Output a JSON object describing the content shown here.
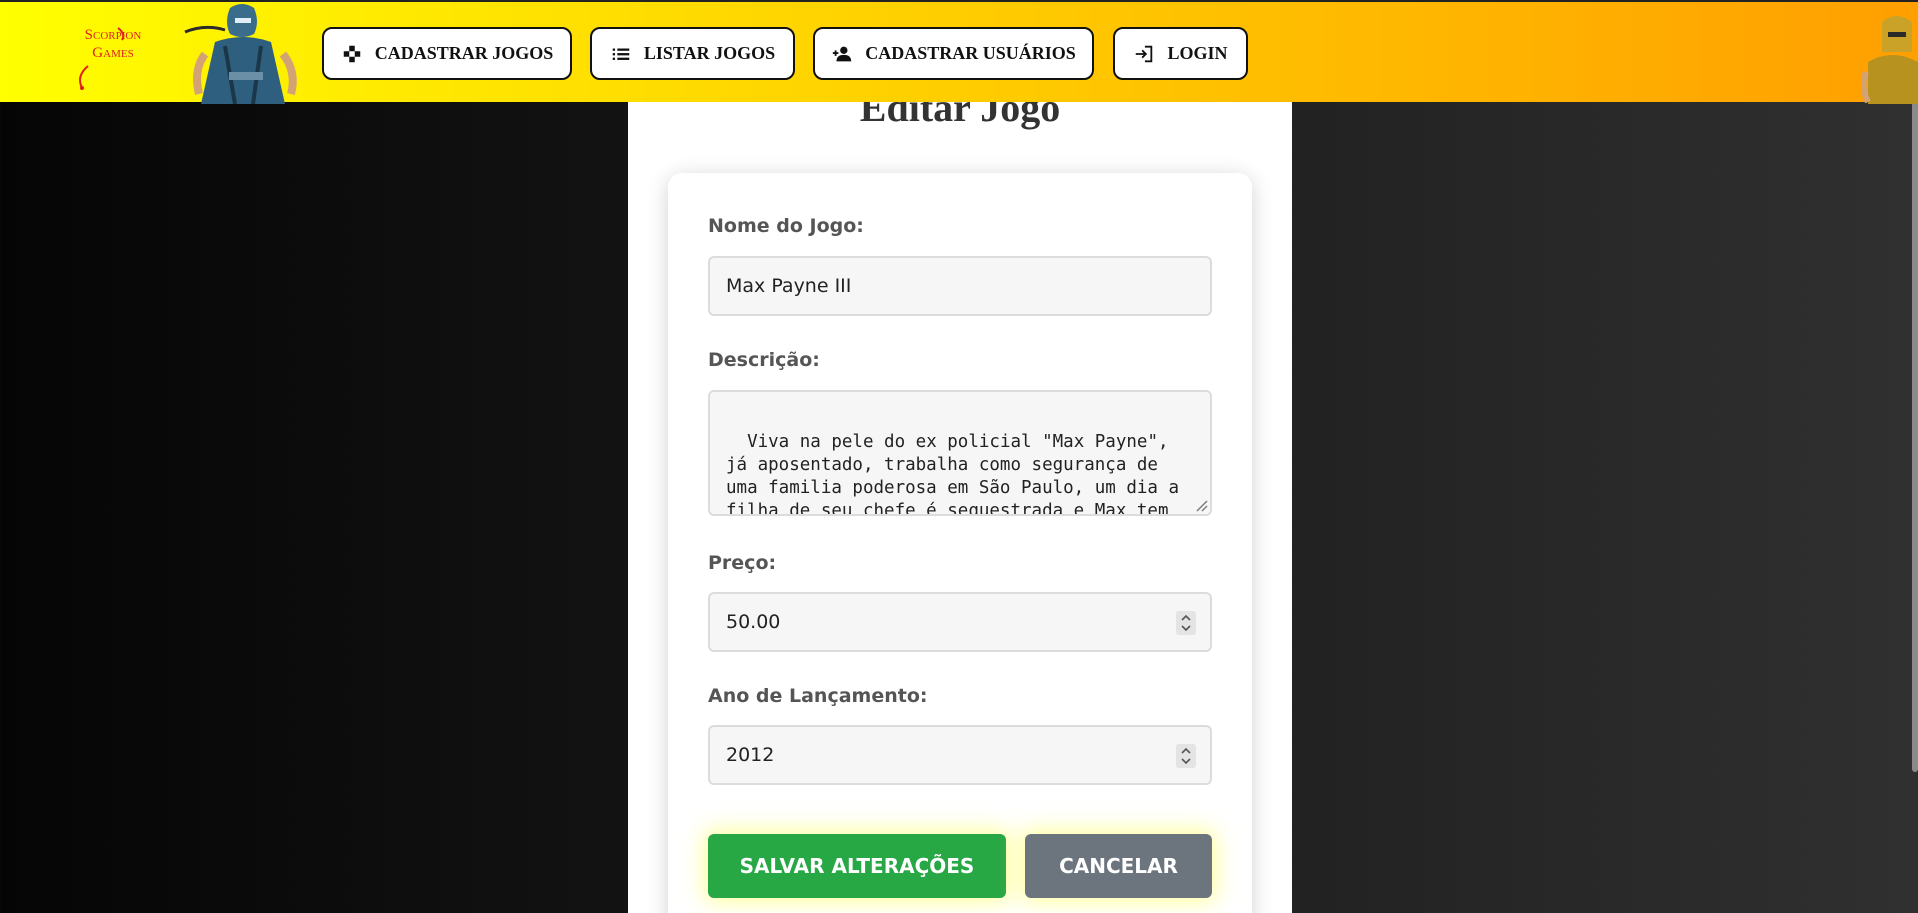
{
  "header": {
    "logo_line1": "Scorpion",
    "logo_line2": "Games",
    "nav": [
      {
        "label": "CADASTRAR JOGOS",
        "icon": "gamepad-icon"
      },
      {
        "label": "LISTAR JOGOS",
        "icon": "list-icon"
      },
      {
        "label": "CADASTRAR USUÁRIOS",
        "icon": "add-user-icon"
      },
      {
        "label": "LOGIN",
        "icon": "login-icon"
      }
    ]
  },
  "page": {
    "title": "Editar Jogo"
  },
  "form": {
    "name_label": "Nome do Jogo:",
    "name_value": "Max Payne III",
    "description_label": "Descrição:",
    "description_value": "Viva na pele do ex policial \"Max Payne\", já aposentado, trabalha como segurança de uma familia poderosa em São Paulo, um dia a filha de seu chefe é sequestrada e Max tem que investigar diversas facções",
    "price_label": "Preço:",
    "price_value": "50.00",
    "year_label": "Ano de Lançamento:",
    "year_value": "2012",
    "save_label": "SALVAR ALTERAÇÕES",
    "cancel_label": "CANCELAR"
  },
  "colors": {
    "header_start": "#ffff00",
    "header_end": "#ff9f00",
    "save": "#28a745",
    "cancel": "#6c757d",
    "logo": "#e02020"
  }
}
